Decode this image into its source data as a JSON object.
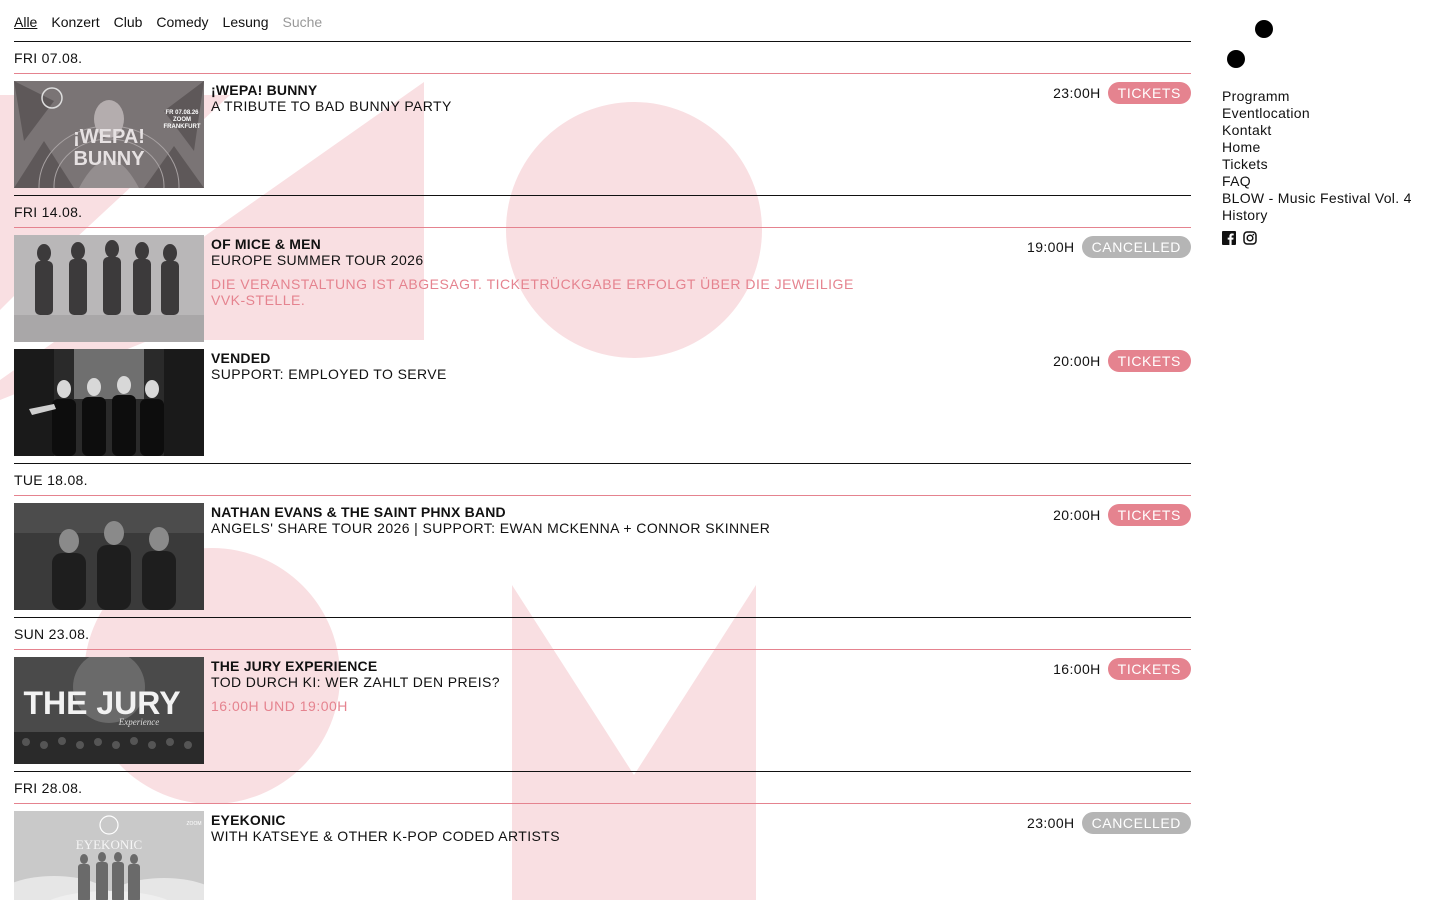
{
  "filters": [
    {
      "label": "Alle",
      "state": "active"
    },
    {
      "label": "Konzert",
      "state": "normal"
    },
    {
      "label": "Club",
      "state": "normal"
    },
    {
      "label": "Comedy",
      "state": "normal"
    },
    {
      "label": "Lesung",
      "state": "normal"
    },
    {
      "label": "Suche",
      "state": "muted"
    }
  ],
  "days": [
    {
      "date": "FRI 07.08.",
      "events": [
        {
          "title": "¡WEPA! BUNNY",
          "subtitle": "A TRIBUTE TO BAD BUNNY PARTY",
          "note": "",
          "time": "23:00H",
          "status": "TICKETS"
        }
      ]
    },
    {
      "date": "FRI 14.08.",
      "events": [
        {
          "title": "OF MICE & MEN",
          "subtitle": "EUROPE SUMMER TOUR 2026",
          "note": "DIE VERANSTALTUNG IST ABGESAGT. TICKETRÜCKGABE ERFOLGT ÜBER DIE JEWEILIGE VVK-STELLE.",
          "time": "19:00H",
          "status": "CANCELLED"
        },
        {
          "title": "VENDED",
          "subtitle": "SUPPORT: EMPLOYED TO SERVE",
          "note": "",
          "time": "20:00H",
          "status": "TICKETS"
        }
      ]
    },
    {
      "date": "TUE 18.08.",
      "events": [
        {
          "title": "NATHAN EVANS & THE SAINT PHNX BAND",
          "subtitle": "ANGELS' SHARE TOUR 2026 | SUPPORT: EWAN MCKENNA + CONNOR SKINNER",
          "note": "",
          "time": "20:00H",
          "status": "TICKETS"
        }
      ]
    },
    {
      "date": "SUN 23.08.",
      "events": [
        {
          "title": "THE JURY EXPERIENCE",
          "subtitle": "TOD DURCH KI: WER ZAHLT DEN PREIS?",
          "note": "16:00H UND 19:00H",
          "time": "16:00H",
          "status": "TICKETS"
        }
      ]
    },
    {
      "date": "FRI 28.08.",
      "events": [
        {
          "title": "EYEKONIC",
          "subtitle": "WITH KATSEYE & OTHER K-POP CODED ARTISTS",
          "note": "",
          "time": "23:00H",
          "status": "CANCELLED"
        }
      ]
    }
  ],
  "thumbnails": {
    "wepa": {
      "line1": "¡WEPA!",
      "line2": "BUNNY",
      "badge1": "FR 07.08.26",
      "badge2": "ZOOM",
      "badge3": "FRANKFURT"
    },
    "jury": {
      "line1": "THE JURY",
      "line2": "Experience"
    },
    "eyekonic": {
      "line1": "EYEKONIC",
      "badge": "ZOOM"
    }
  },
  "sidebar": {
    "nav": [
      "Programm",
      "Eventlocation",
      "Kontakt",
      "Home",
      "Tickets",
      "FAQ",
      "BLOW - Music Festival Vol. 4",
      "History"
    ],
    "social": [
      "facebook-icon",
      "instagram-icon"
    ]
  },
  "colors": {
    "accent": "#e5838f",
    "shape": "#f9dfe2",
    "cancelled": "#b5b5b5"
  }
}
